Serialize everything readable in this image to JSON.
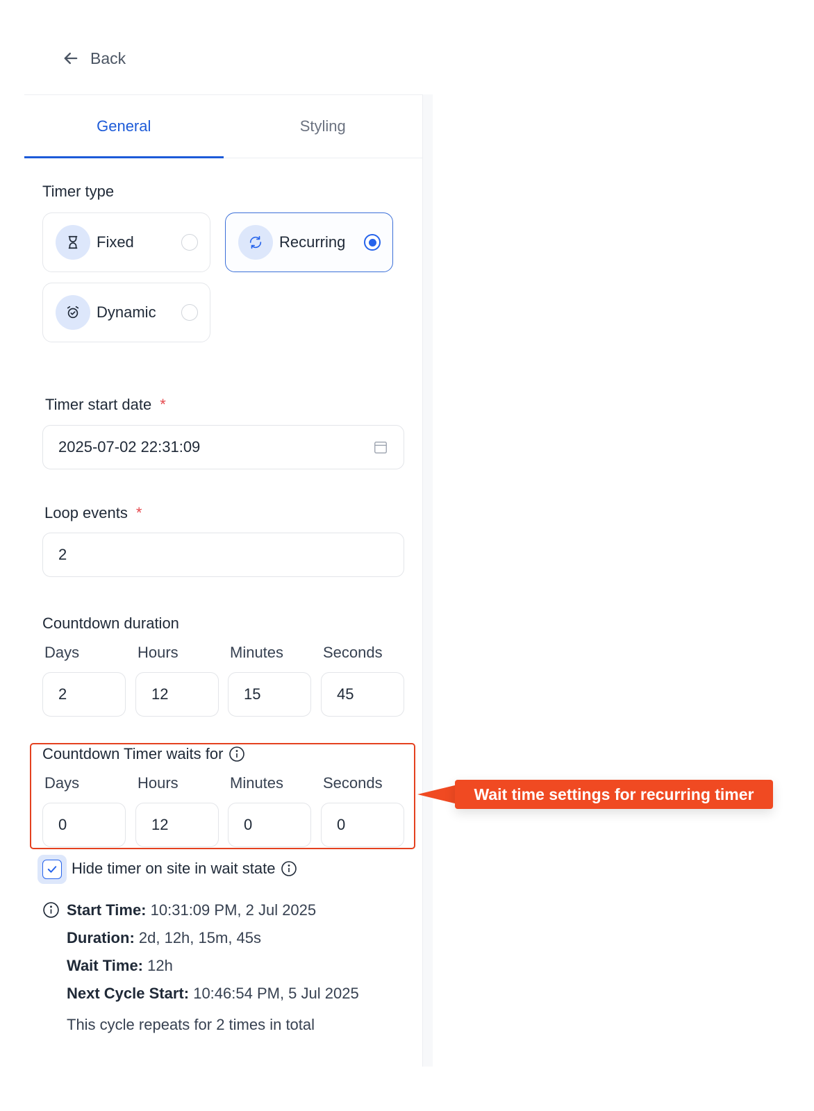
{
  "back_label": "Back",
  "tabs": [
    {
      "label": "General",
      "active": true
    },
    {
      "label": "Styling",
      "active": false
    }
  ],
  "timer_type": {
    "label": "Timer type",
    "options": [
      {
        "label": "Fixed",
        "icon": "hourglass-icon",
        "selected": false
      },
      {
        "label": "Recurring",
        "icon": "refresh-icon",
        "selected": true
      },
      {
        "label": "Dynamic",
        "icon": "alarm-clock-icon",
        "selected": false
      }
    ]
  },
  "start_date": {
    "label": "Timer start date",
    "required_mark": "*",
    "value": "2025-07-02 22:31:09"
  },
  "loop_events": {
    "label": "Loop events",
    "required_mark": "*",
    "value": "2"
  },
  "countdown_duration": {
    "label": "Countdown duration",
    "fields": [
      {
        "label": "Days",
        "value": "2"
      },
      {
        "label": "Hours",
        "value": "12"
      },
      {
        "label": "Minutes",
        "value": "15"
      },
      {
        "label": "Seconds",
        "value": "45"
      }
    ]
  },
  "wait": {
    "label": "Countdown Timer waits for",
    "fields": [
      {
        "label": "Days",
        "value": "0"
      },
      {
        "label": "Hours",
        "value": "12"
      },
      {
        "label": "Minutes",
        "value": "0"
      },
      {
        "label": "Seconds",
        "value": "0"
      }
    ]
  },
  "hide_timer": {
    "label": "Hide timer on site in wait state",
    "checked": true
  },
  "summary": {
    "start_time_label": "Start Time:",
    "start_time_value": "10:31:09 PM, 2 Jul 2025",
    "duration_label": "Duration:",
    "duration_value": "2d, 12h, 15m, 45s",
    "wait_time_label": "Wait Time:",
    "wait_time_value": "12h",
    "next_cycle_label": "Next Cycle Start:",
    "next_cycle_value": "10:46:54 PM, 5 Jul 2025",
    "repeat_note": "This cycle repeats for 2 times in total"
  },
  "callout": "Wait time settings for recurring timer",
  "colors": {
    "accent": "#1d5bd8",
    "callout": "#f04a22",
    "highlight_border": "#e4411f",
    "required": "#e5484d"
  }
}
